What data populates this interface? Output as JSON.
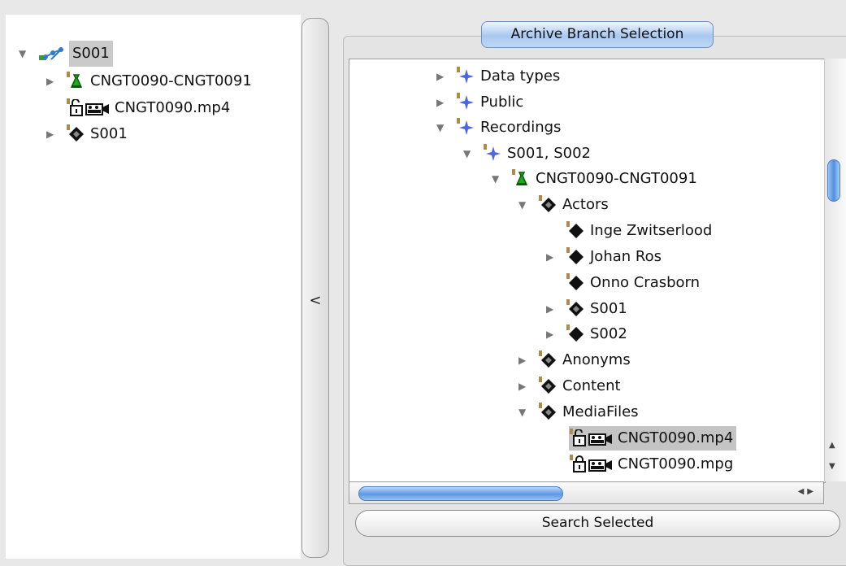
{
  "left_tree": {
    "nodes": [
      {
        "label": "S001",
        "icon": "network-corpus-icon",
        "expanded": true,
        "selected": true
      },
      {
        "label": "CNGT0090-CNGT0091",
        "icon": "session-bag-icon",
        "expanded": false
      },
      {
        "label": "CNGT0090.mp4",
        "icon": "unlocked-video-file-icon"
      },
      {
        "label": "S001",
        "icon": "gray-diamond-icon",
        "expanded": false
      }
    ]
  },
  "divider": {
    "collapse_label": "<"
  },
  "archive_panel": {
    "title": "Archive Branch Selection",
    "tree": [
      {
        "label": "Data types",
        "icon": "corpus-star-icon",
        "expanded": false
      },
      {
        "label": "Public",
        "icon": "corpus-star-icon",
        "expanded": false
      },
      {
        "label": "Recordings",
        "icon": "corpus-star-icon",
        "expanded": true
      },
      {
        "label": "S001, S002",
        "icon": "corpus-star-icon",
        "expanded": true
      },
      {
        "label": "CNGT0090-CNGT0091",
        "icon": "session-bag-icon",
        "expanded": true
      },
      {
        "label": "Actors",
        "icon": "gray-diamond-icon",
        "expanded": true
      },
      {
        "label": "Inge Zwitserlood",
        "icon": "black-diamond-icon"
      },
      {
        "label": "Johan Ros",
        "icon": "black-diamond-icon",
        "expanded": false
      },
      {
        "label": "Onno Crasborn",
        "icon": "black-diamond-icon"
      },
      {
        "label": "S001",
        "icon": "gray-diamond-icon",
        "expanded": false
      },
      {
        "label": "S002",
        "icon": "black-diamond-icon",
        "expanded": false
      },
      {
        "label": "Anonyms",
        "icon": "gray-diamond-icon",
        "expanded": false
      },
      {
        "label": "Content",
        "icon": "gray-diamond-icon",
        "expanded": false
      },
      {
        "label": "MediaFiles",
        "icon": "gray-diamond-icon",
        "expanded": true
      },
      {
        "label": "CNGT0090.mp4",
        "icon": "unlocked-video-file-icon",
        "selected": true
      },
      {
        "label": "CNGT0090.mpg",
        "icon": "locked-video-file-icon"
      }
    ],
    "search_button": "Search Selected"
  },
  "colors": {
    "selection": "#c4c4c4",
    "scroll_thumb": "#5b98e4",
    "corpus_star": "#4f64e0",
    "session_green": "#1fa81f",
    "file_marker": "#b08a4a"
  }
}
